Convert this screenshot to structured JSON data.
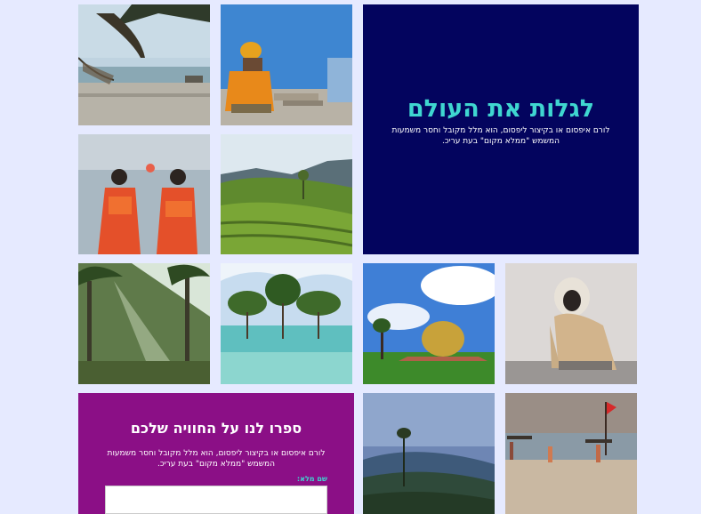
{
  "hero": {
    "title": "לגלות את העולם",
    "text": "לורם איפסום או בקיצור ליפסום, הוא מלל מקובל וחסר משמעות המשמש \"ממלא מקום\" בעת עריכ."
  },
  "feedback_form": {
    "title": "ספרו לנו על החוויה שלכם",
    "text": "לורם איפסום או בקיצור ליפסום, הוא מלל מקובל וחסר משמעות המשמש \"ממלא מקום\" בעת עריכ.",
    "full_name_label": "שם מלא:",
    "full_name_value": "",
    "full_name_placeholder": ""
  },
  "gallery": {
    "photos": [
      "beach-hammock-tree-photo",
      "sadhu-blue-wall-photo",
      "women-saris-sunset-photo",
      "tea-plantation-hills-photo",
      "palm-forest-sunrays-photo",
      "mangrove-trees-water-photo",
      "golden-dome-matrimandir-photo",
      "langur-monkey-photo",
      "misty-hills-forest-photo",
      "beach-fishermen-flag-photo"
    ]
  },
  "colors": {
    "page_background": "#e6eaff",
    "hero_background": "#03045e",
    "hero_title": "#3fd6d0",
    "form_background": "#8b0f86"
  }
}
